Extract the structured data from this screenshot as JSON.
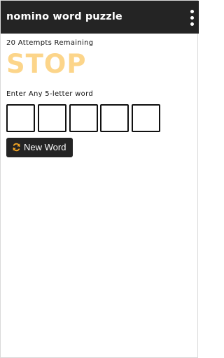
{
  "app_bar": {
    "title": "nomino word puzzle",
    "menu_icon": "more-vert-icon"
  },
  "game": {
    "attempts_text": "20 Attempts Remaining",
    "status_word": "STOP",
    "status_color": "#fcd58a",
    "prompt": "Enter Any 5-letter word",
    "tiles": [
      "",
      "",
      "",
      "",
      ""
    ],
    "new_word_button": {
      "label": "New Word",
      "icon": "refresh-icon",
      "icon_color": "#f5a623"
    }
  },
  "theme": {
    "bar_background": "#242424",
    "text": "#111111"
  }
}
